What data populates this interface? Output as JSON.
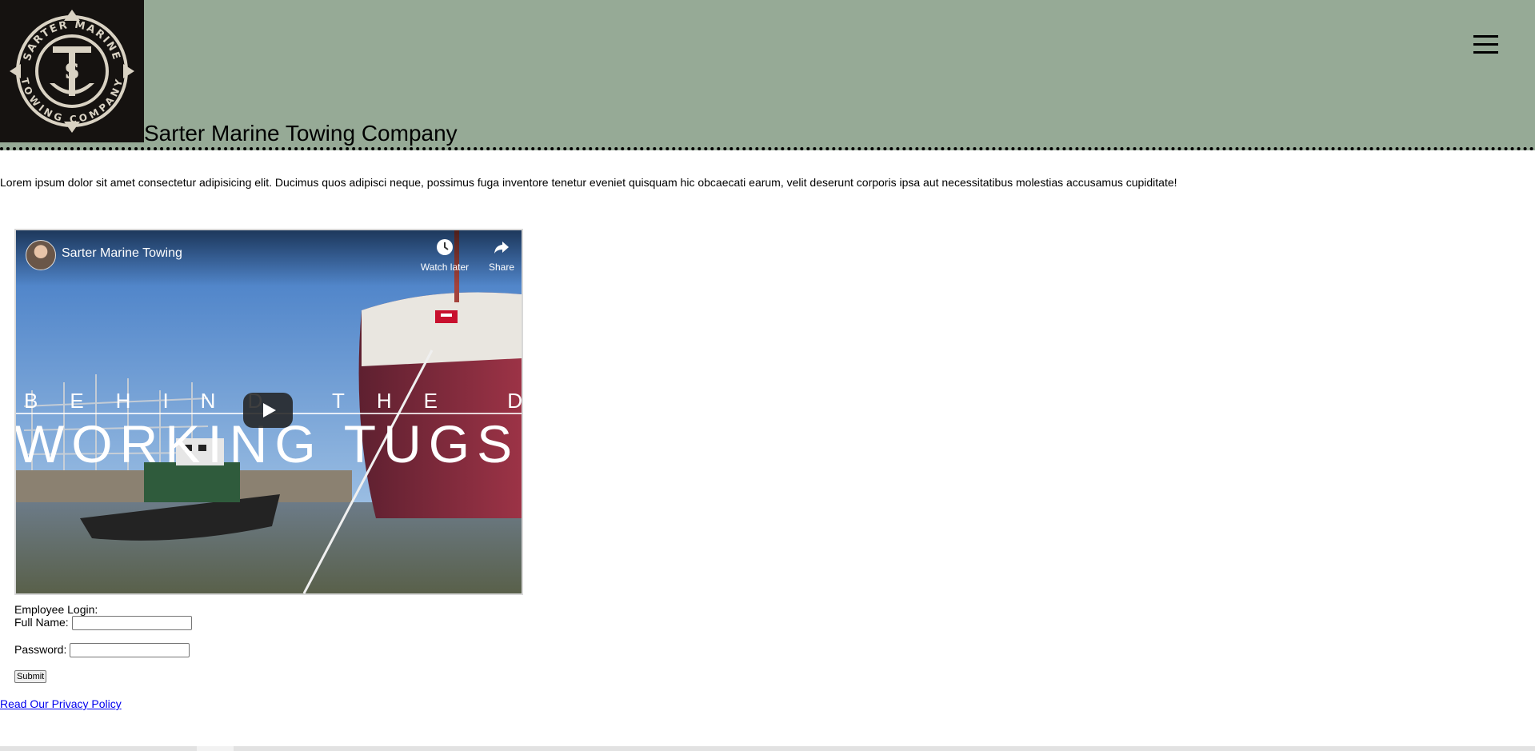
{
  "header": {
    "logo": {
      "alt_icon": "sarter-marine-anchor-seal",
      "lettering_top": "SARTER MARINE",
      "lettering_bottom": "TOWING COMPANY",
      "monogram": "STS"
    },
    "title": "Sarter Marine Towing Company",
    "menu_icon": "hamburger-menu-icon"
  },
  "intro_text": "Lorem ipsum dolor sit amet consectetur adipisicing elit. Ducimus quos adipisci neque, possimus fuga inventore tenetur eveniet quisquam hic obcaecati earum, velit deserunt corporis ipsa aut necessitatibus molestias accusamus cupiditate!",
  "video": {
    "title": "Sarter Marine Towing",
    "watch_later": "Watch later",
    "share": "Share",
    "overlay_line1": "BEHIND THE DOOR",
    "overlay_line2": "WORKING TUGS",
    "play_icon": "play-icon"
  },
  "login": {
    "heading": "Employee Login:",
    "full_name_label": "Full Name:",
    "full_name_value": "",
    "password_label": "Password:",
    "password_value": "",
    "submit_label": "Submit"
  },
  "privacy_link": "Read Our Privacy Policy",
  "colors": {
    "header_bg": "#96aa96",
    "link": "#0000ee"
  }
}
